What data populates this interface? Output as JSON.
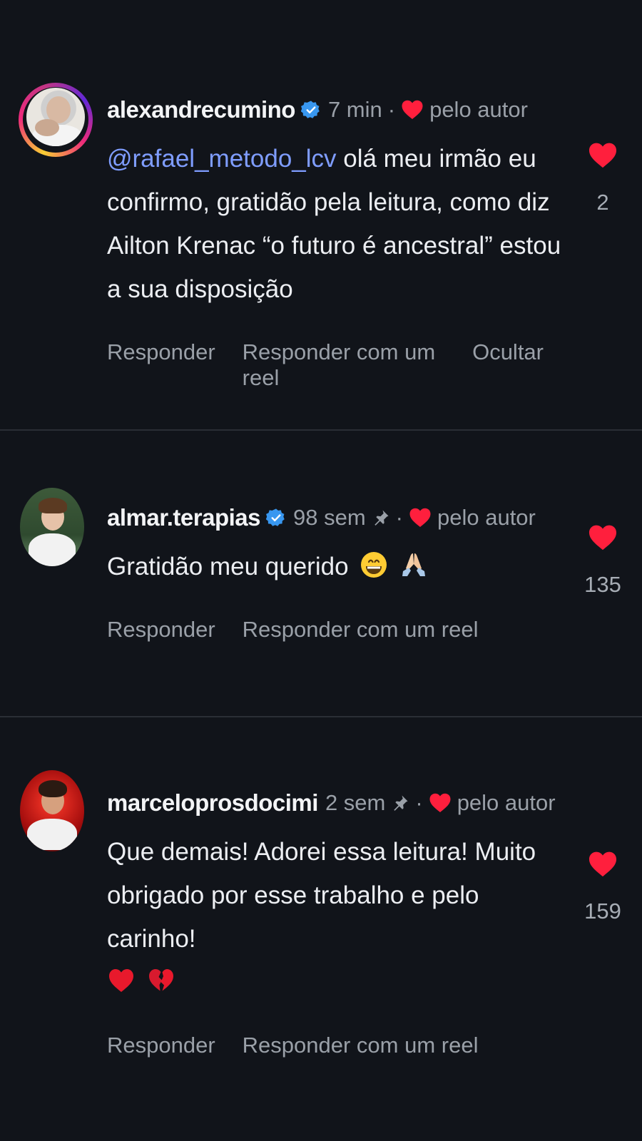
{
  "colors": {
    "background": "#11141a",
    "heart": "#ff1f3d",
    "verified": "#3897f0",
    "mention": "#7f9dff",
    "muted": "#9aa0a8"
  },
  "comments": [
    {
      "username": "alexandrecumino",
      "verified": true,
      "time": "7 min",
      "pinned": false,
      "liked_by_author_label": "pelo autor",
      "mention": "@rafael_metodo_lcv",
      "text": " olá meu irmão eu confirmo, gratidão pela leitura, como diz Ailton Krenac “o futuro é ancestral” estou a sua disposição",
      "emojis": [],
      "likes": "2",
      "actions": [
        "Responder",
        "Responder com um reel",
        "Ocultar"
      ],
      "avatar_icon": "story-ring-avatar"
    },
    {
      "username": "almar.terapias",
      "verified": true,
      "time": "98 sem",
      "pinned": true,
      "liked_by_author_label": "pelo autor",
      "mention": "",
      "text": "Gratidão meu querido",
      "emojis": [
        "grinning-face-emoji",
        "folded-hands-emoji"
      ],
      "likes": "135",
      "actions": [
        "Responder",
        "Responder com um reel"
      ],
      "avatar_icon": "user-avatar"
    },
    {
      "username": "marceloprosdocimi",
      "verified": false,
      "time": "2 sem",
      "pinned": true,
      "liked_by_author_label": "pelo autor",
      "mention": "",
      "text": "Que demais! Adorei essa leitura! Muito obrigado por esse trabalho e pelo carinho!",
      "emojis": [
        "red-heart-emoji",
        "broken-heart-emoji"
      ],
      "likes": "159",
      "actions": [
        "Responder",
        "Responder com um reel"
      ],
      "avatar_icon": "user-avatar"
    }
  ]
}
